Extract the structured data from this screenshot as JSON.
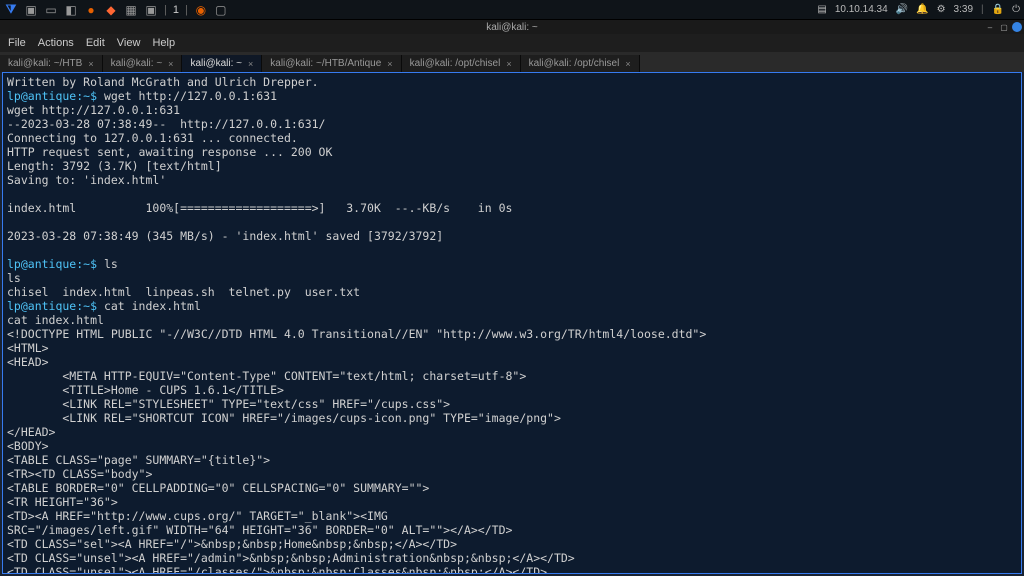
{
  "taskbar": {
    "workspace": "1",
    "ip": "10.10.14.34",
    "time": "3:39"
  },
  "window": {
    "title": "kali@kali: ~"
  },
  "menubar": {
    "file": "File",
    "actions": "Actions",
    "edit": "Edit",
    "view": "View",
    "help": "Help"
  },
  "tabs": [
    {
      "label": "kali@kali: ~/HTB"
    },
    {
      "label": "kali@kali: ~"
    },
    {
      "label": "kali@kali: ~"
    },
    {
      "label": "kali@kali: ~/HTB/Antique"
    },
    {
      "label": "kali@kali: /opt/chisel"
    },
    {
      "label": "kali@kali: /opt/chisel"
    }
  ],
  "term": {
    "l0": "Written by Roland McGrath and Ulrich Drepper.",
    "l1a": "lp@antique:~$",
    "l1b": " wget http://127.0.0.1:631",
    "l2": "wget http://127.0.0.1:631",
    "l3": "--2023-03-28 07:38:49--  http://127.0.0.1:631/",
    "l4": "Connecting to 127.0.0.1:631 ... connected.",
    "l5": "HTTP request sent, awaiting response ... 200 OK",
    "l6": "Length: 3792 (3.7K) [text/html]",
    "l7": "Saving to: 'index.html'",
    "l8": "",
    "l9": "index.html          100%[===================>]   3.70K  --.-KB/s    in 0s",
    "l10": "",
    "l11": "2023-03-28 07:38:49 (345 MB/s) - 'index.html' saved [3792/3792]",
    "l12": "",
    "l13a": "lp@antique:~$",
    "l13b": " ls",
    "l14": "ls",
    "l15": "chisel  index.html  linpeas.sh  telnet.py  user.txt",
    "l16a": "lp@antique:~$",
    "l16b": " cat index.html",
    "l17": "cat index.html",
    "l18": "<!DOCTYPE HTML PUBLIC \"-//W3C//DTD HTML 4.0 Transitional//EN\" \"http://www.w3.org/TR/html4/loose.dtd\">",
    "l19": "<HTML>",
    "l20": "<HEAD>",
    "l21": "        <META HTTP-EQUIV=\"Content-Type\" CONTENT=\"text/html; charset=utf-8\">",
    "l22": "        <TITLE>Home - CUPS 1.6.1</TITLE>",
    "l23": "        <LINK REL=\"STYLESHEET\" TYPE=\"text/css\" HREF=\"/cups.css\">",
    "l24": "        <LINK REL=\"SHORTCUT ICON\" HREF=\"/images/cups-icon.png\" TYPE=\"image/png\">",
    "l25": "</HEAD>",
    "l26": "<BODY>",
    "l27": "<TABLE CLASS=\"page\" SUMMARY=\"{title}\">",
    "l28": "<TR><TD CLASS=\"body\">",
    "l29": "<TABLE BORDER=\"0\" CELLPADDING=\"0\" CELLSPACING=\"0\" SUMMARY=\"\">",
    "l30": "<TR HEIGHT=\"36\">",
    "l31": "<TD><A HREF=\"http://www.cups.org/\" TARGET=\"_blank\"><IMG",
    "l32": "SRC=\"/images/left.gif\" WIDTH=\"64\" HEIGHT=\"36\" BORDER=\"0\" ALT=\"\"></A></TD>",
    "l33": "<TD CLASS=\"sel\"><A HREF=\"/\">&nbsp;&nbsp;Home&nbsp;&nbsp;</A></TD>",
    "l34": "<TD CLASS=\"unsel\"><A HREF=\"/admin\">&nbsp;&nbsp;Administration&nbsp;&nbsp;</A></TD>",
    "l35": "<TD CLASS=\"unsel\"><A HREF=\"/classes/\">&nbsp;&nbsp;Classes&nbsp;&nbsp;</A></TD>"
  }
}
